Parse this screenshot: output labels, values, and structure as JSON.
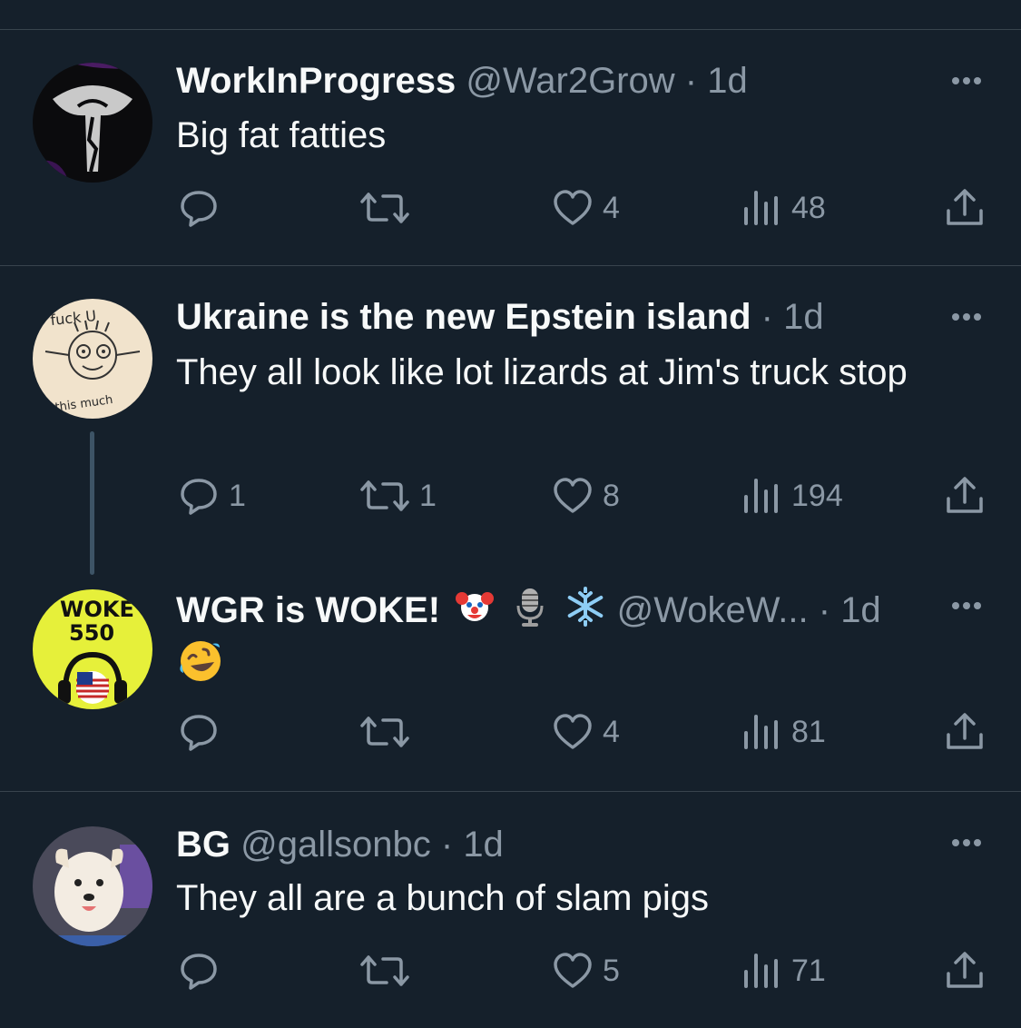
{
  "tweets": [
    {
      "name": "WorkInProgress",
      "handle": "@War2Grow",
      "dot": "·",
      "time": "1d",
      "text": "Big fat fatties",
      "replies": "",
      "retweets": "",
      "likes": "4",
      "views": "48"
    },
    {
      "name": "Ukraine is the new Epstein island",
      "handle": "",
      "dot": "·",
      "time": "1d",
      "text": "They all look like lot lizards at Jim's truck stop",
      "replies": "1",
      "retweets": "1",
      "likes": "8",
      "views": "194",
      "avatar_text_top": "fuck U",
      "avatar_text_bottom": "this much"
    },
    {
      "name": "WGR is WOKE!",
      "name_emojis": [
        "clown-face",
        "microphone",
        "snowflake"
      ],
      "handle": "@WokeW...",
      "dot": "·",
      "time": "1d",
      "text_emoji": "rolling-on-floor-laughing",
      "replies": "",
      "retweets": "",
      "likes": "4",
      "views": "81",
      "avatar_text_line1": "WOKE",
      "avatar_text_line2": "550"
    },
    {
      "name": "BG",
      "handle": "@gallsonbc",
      "dot": "·",
      "time": "1d",
      "text": "They all are a bunch of slam pigs",
      "replies": "",
      "retweets": "",
      "likes": "5",
      "views": "71"
    }
  ],
  "colors": {
    "background": "#15202b",
    "divider": "#38444d",
    "muted": "#8b98a5",
    "text": "#f7f9f9"
  }
}
